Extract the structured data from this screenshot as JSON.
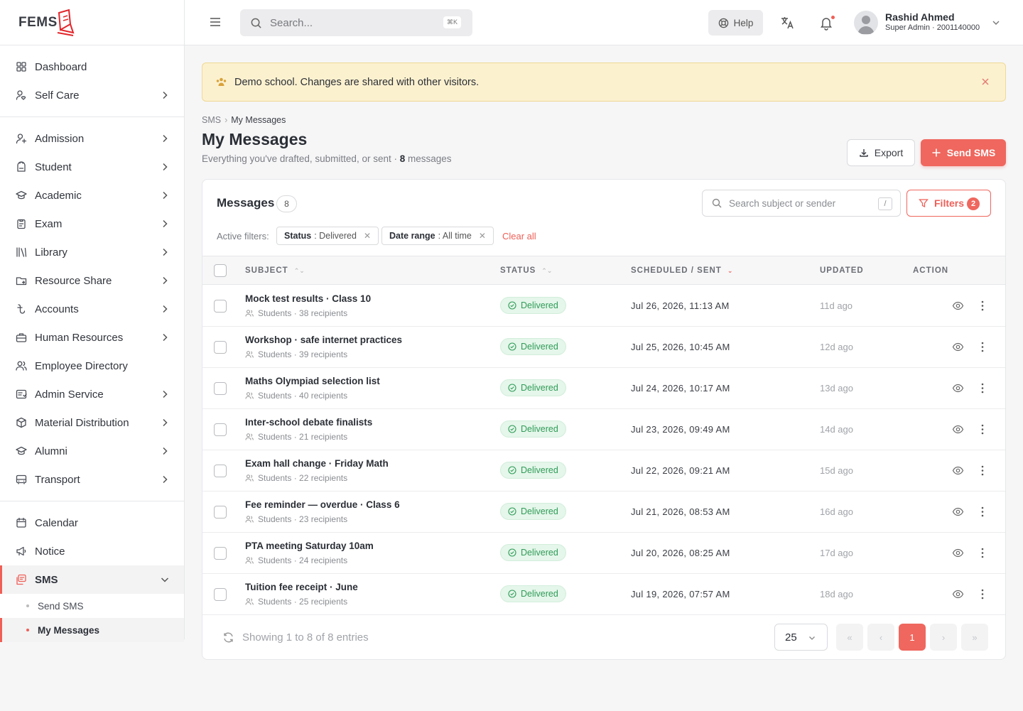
{
  "brand": {
    "name": "FEMS"
  },
  "sidebar": {
    "group1": [
      {
        "label": "Dashboard",
        "icon": "dashboard-icon",
        "chevron": false
      },
      {
        "label": "Self Care",
        "icon": "user-heart-icon",
        "chevron": true
      }
    ],
    "group2": [
      {
        "label": "Admission",
        "icon": "user-plus-icon",
        "chevron": true
      },
      {
        "label": "Student",
        "icon": "backpack-icon",
        "chevron": true
      },
      {
        "label": "Academic",
        "icon": "graduation-cap-icon",
        "chevron": true
      },
      {
        "label": "Exam",
        "icon": "clipboard-icon",
        "chevron": true
      },
      {
        "label": "Library",
        "icon": "library-icon",
        "chevron": true
      },
      {
        "label": "Resource Share",
        "icon": "folder-share-icon",
        "chevron": true
      },
      {
        "label": "Accounts",
        "icon": "taka-icon",
        "chevron": true
      },
      {
        "label": "Human Resources",
        "icon": "briefcase-icon",
        "chevron": true
      },
      {
        "label": "Employee Directory",
        "icon": "users-icon",
        "chevron": false
      },
      {
        "label": "Admin Service",
        "icon": "admin-icon",
        "chevron": true
      },
      {
        "label": "Material Distribution",
        "icon": "box-icon",
        "chevron": true
      },
      {
        "label": "Alumni",
        "icon": "graduation-cap-icon",
        "chevron": true
      },
      {
        "label": "Transport",
        "icon": "bus-icon",
        "chevron": true
      }
    ],
    "group3": [
      {
        "label": "Calendar",
        "icon": "calendar-icon",
        "chevron": false
      },
      {
        "label": "Notice",
        "icon": "megaphone-icon",
        "chevron": false
      },
      {
        "label": "SMS",
        "icon": "sms-icon",
        "chevron": true,
        "active": true
      }
    ],
    "sms_sub": [
      {
        "label": "Send SMS",
        "active": false
      },
      {
        "label": "My Messages",
        "active": true
      }
    ]
  },
  "topbar": {
    "search_placeholder": "Search...",
    "shortcut": "⌘K",
    "help_label": "Help",
    "user_name": "Rashid Ahmed",
    "user_role": "Super Admin · 2001140000"
  },
  "banner": {
    "text": "Demo school. Changes are shared with other visitors."
  },
  "breadcrumb": {
    "parent": "SMS",
    "current": "My Messages"
  },
  "page": {
    "title": "My Messages",
    "subtitle_prefix": "Everything you've drafted, submitted, or sent · ",
    "subtitle_count": "8",
    "subtitle_suffix": " messages",
    "export_label": "Export",
    "send_label": "Send SMS"
  },
  "card": {
    "title": "Messages",
    "count": "8",
    "search_placeholder": "Search subject or sender",
    "search_shortcut": "/",
    "filters_label": "Filters",
    "filters_count": "2",
    "active_filters_label": "Active filters:",
    "chips": [
      {
        "key": "Status",
        "value": ": Delivered"
      },
      {
        "key": "Date range",
        "value": ": All time"
      }
    ],
    "clear_all": "Clear all"
  },
  "table": {
    "headers": {
      "subject": "SUBJECT",
      "status": "STATUS",
      "scheduled": "SCHEDULED / SENT",
      "updated": "UPDATED",
      "action": "ACTION"
    },
    "rows": [
      {
        "subject": "Mock test results · Class 10",
        "meta": "Students · 38 recipients",
        "status": "Delivered",
        "scheduled": "Jul 26, 2026, 11:13 AM",
        "updated": "11d ago"
      },
      {
        "subject": "Workshop · safe internet practices",
        "meta": "Students · 39 recipients",
        "status": "Delivered",
        "scheduled": "Jul 25, 2026, 10:45 AM",
        "updated": "12d ago"
      },
      {
        "subject": "Maths Olympiad selection list",
        "meta": "Students · 40 recipients",
        "status": "Delivered",
        "scheduled": "Jul 24, 2026, 10:17 AM",
        "updated": "13d ago"
      },
      {
        "subject": "Inter-school debate finalists",
        "meta": "Students · 21 recipients",
        "status": "Delivered",
        "scheduled": "Jul 23, 2026, 09:49 AM",
        "updated": "14d ago"
      },
      {
        "subject": "Exam hall change · Friday Math",
        "meta": "Students · 22 recipients",
        "status": "Delivered",
        "scheduled": "Jul 22, 2026, 09:21 AM",
        "updated": "15d ago"
      },
      {
        "subject": "Fee reminder — overdue · Class 6",
        "meta": "Students · 23 recipients",
        "status": "Delivered",
        "scheduled": "Jul 21, 2026, 08:53 AM",
        "updated": "16d ago"
      },
      {
        "subject": "PTA meeting Saturday 10am",
        "meta": "Students · 24 recipients",
        "status": "Delivered",
        "scheduled": "Jul 20, 2026, 08:25 AM",
        "updated": "17d ago"
      },
      {
        "subject": "Tuition fee receipt · June",
        "meta": "Students · 25 recipients",
        "status": "Delivered",
        "scheduled": "Jul 19, 2026, 07:57 AM",
        "updated": "18d ago"
      }
    ]
  },
  "pagination": {
    "summary": "Showing 1 to 8 of 8 entries",
    "page_size": "25",
    "current_page": "1",
    "first": "«",
    "prev": "‹",
    "next": "›",
    "last": "»"
  },
  "colors": {
    "accent": "#ef675e",
    "success": "#2f9c58",
    "banner_bg": "#fcf1cf"
  }
}
